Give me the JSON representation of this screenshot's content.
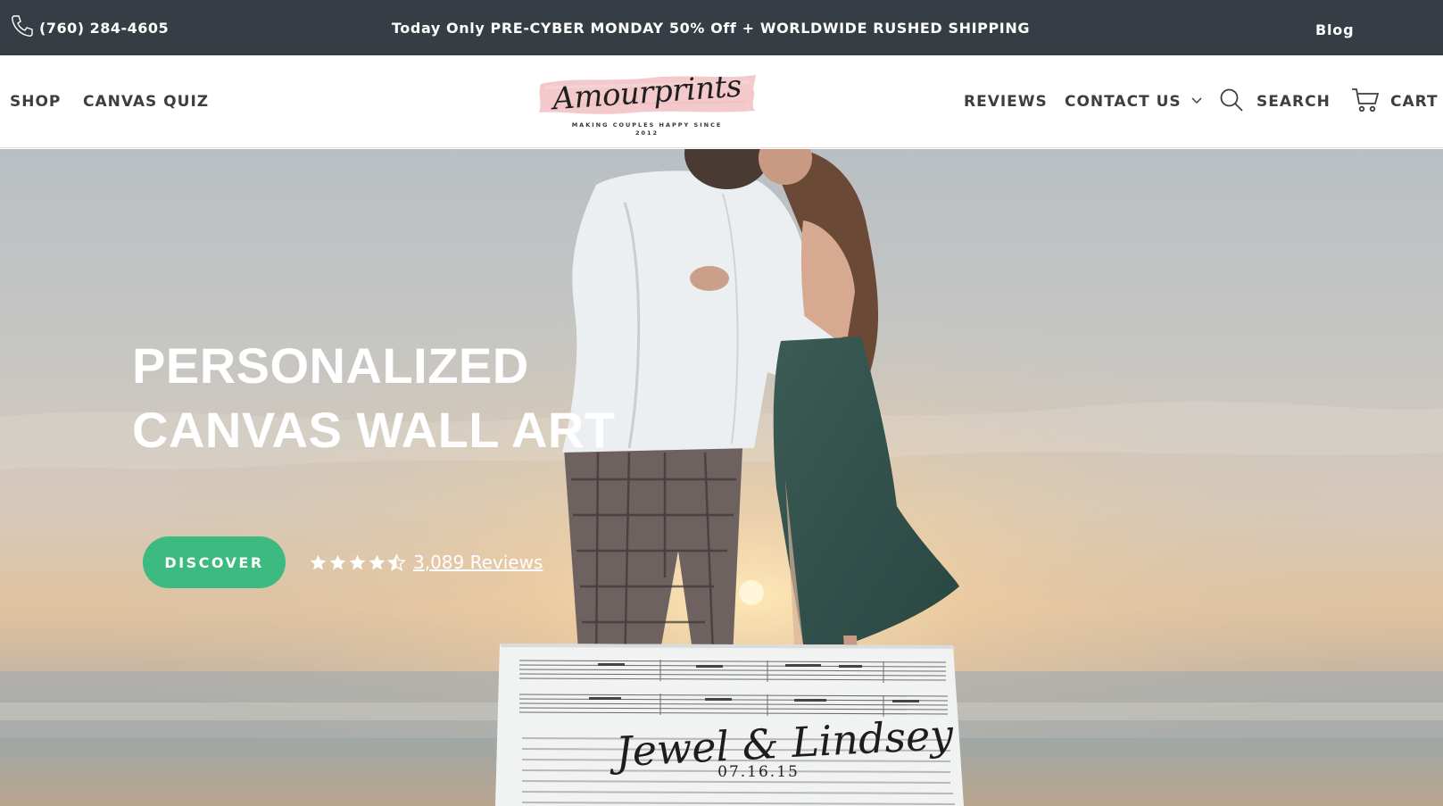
{
  "topbar": {
    "phone": "(760) 284-4605",
    "promo": "Today Only PRE-CYBER MONDAY 50% Off + WORLDWIDE RUSHED SHIPPING",
    "blog": "Blog",
    "background": "#363d44",
    "phone_icon": "phone-icon"
  },
  "header": {
    "nav_left": [
      "SHOP",
      "CANVAS QUIZ"
    ],
    "logo": {
      "wordmark": "Amourprints",
      "tagline_line1": "MAKING COUPLES HAPPY SINCE",
      "tagline_line2": "2012",
      "brush_color": "#f3c9cc"
    },
    "nav_right": {
      "reviews": "REVIEWS",
      "contact": "CONTACT US",
      "search": "SEARCH",
      "cart": "CART"
    },
    "icons": {
      "contact": "chevron-down-icon",
      "search": "search-icon",
      "cart": "cart-icon"
    }
  },
  "hero": {
    "title_line1": "PERSONALIZED",
    "title_line2": "CANVAS WALL ART",
    "cta": "DISCOVER",
    "cta_color": "#3dba80",
    "rating": {
      "stars": 4.5,
      "max_stars": 5,
      "reviews": "3,089 Reviews"
    },
    "sign": {
      "names": "Jewel & Lindsey",
      "date": "07.16.15"
    }
  }
}
